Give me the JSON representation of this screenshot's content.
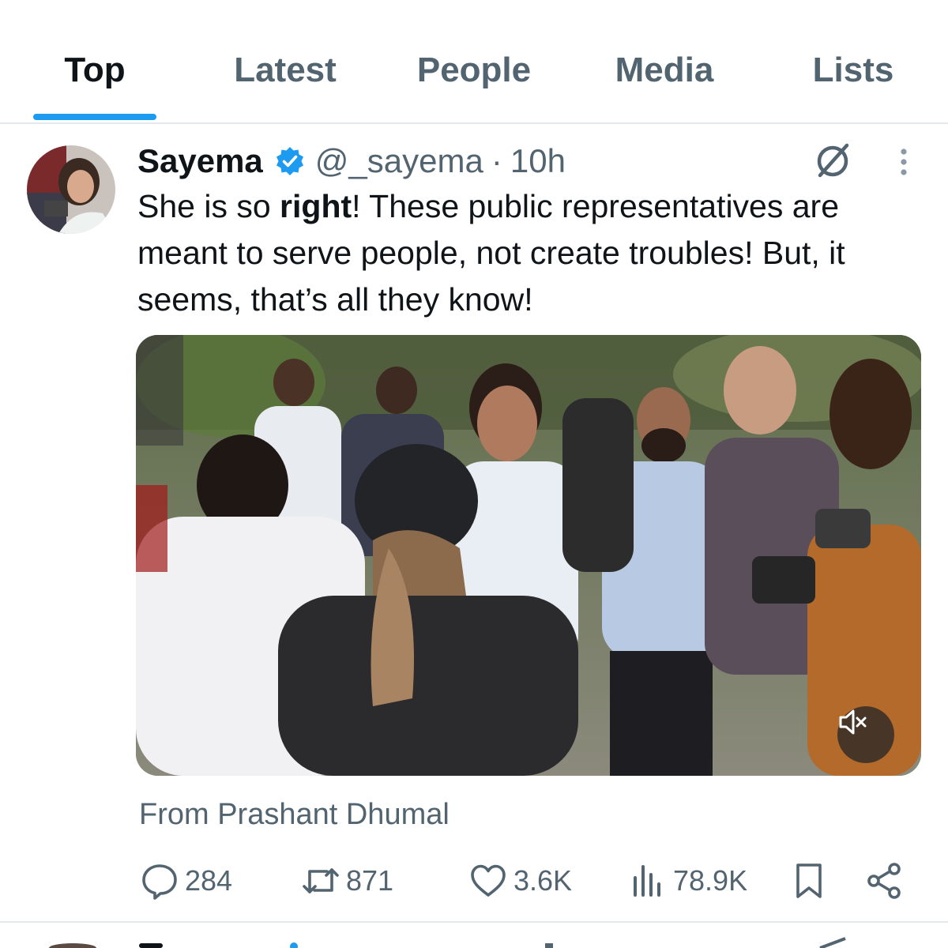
{
  "tabs": [
    {
      "label": "Top",
      "active": true
    },
    {
      "label": "Latest",
      "active": false
    },
    {
      "label": "People",
      "active": false
    },
    {
      "label": "Media",
      "active": false
    },
    {
      "label": "Lists",
      "active": false
    }
  ],
  "accent_color": "#1d9bf0",
  "tweet": {
    "display_name": "Sayema",
    "verified": true,
    "handle": "@_sayema",
    "separator": "·",
    "time": "10h",
    "text": {
      "part1": "She is so ",
      "bold": "right",
      "part2": "! These public representatives are meant to serve people,  not create troubles! But, it seems, that’s all they know!"
    },
    "media": {
      "type": "video",
      "mute_icon": "volume-muted-icon"
    },
    "source": "From Prashant Dhumal",
    "stats": {
      "replies": "284",
      "retweets": "871",
      "likes": "3.6K",
      "views": "78.9K"
    }
  }
}
